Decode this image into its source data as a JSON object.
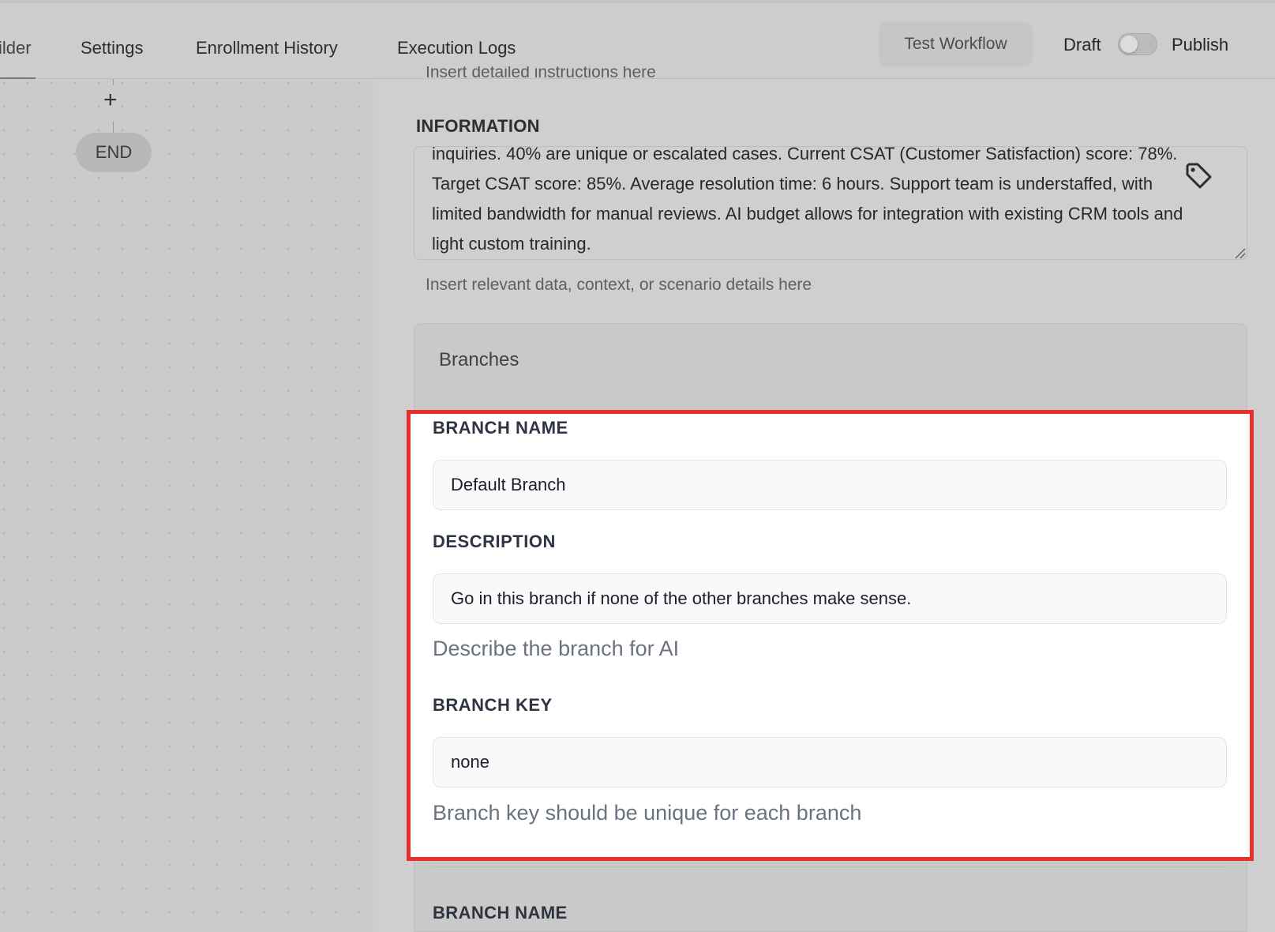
{
  "nav": {
    "tabs": [
      "ilder",
      "Settings",
      "Enrollment History",
      "Execution Logs"
    ],
    "test_workflow": "Test Workflow",
    "draft": "Draft",
    "publish": "Publish"
  },
  "canvas": {
    "plus": "+",
    "end_node": "END"
  },
  "panel": {
    "cut_instructions": "Insert detailed instructions here",
    "information": {
      "label": "INFORMATION",
      "text": "inquiries. 40% are unique or escalated cases. Current CSAT (Customer Satisfaction) score: 78%.  Target CSAT score: 85%.  Average resolution time: 6 hours.  Support team is understaffed, with limited bandwidth for manual reviews.  AI budget allows for integration with existing CRM tools and light custom training.",
      "helper": "Insert relevant data, context, or scenario details here"
    },
    "branches": {
      "header": "Branches",
      "items": [
        {
          "name_label": "BRANCH NAME",
          "name_value": "Default Branch",
          "description_label": "DESCRIPTION",
          "description_value": "Go in this branch if none of the other branches make sense.",
          "description_helper": "Describe the branch for AI",
          "key_label": "BRANCH KEY",
          "key_value": "none",
          "key_helper": "Branch key should be unique for each branch"
        },
        {
          "name_label": "BRANCH NAME"
        }
      ]
    }
  },
  "colors": {
    "highlight_border": "#e8302b",
    "overlay_gray": "#cfcfcf"
  }
}
